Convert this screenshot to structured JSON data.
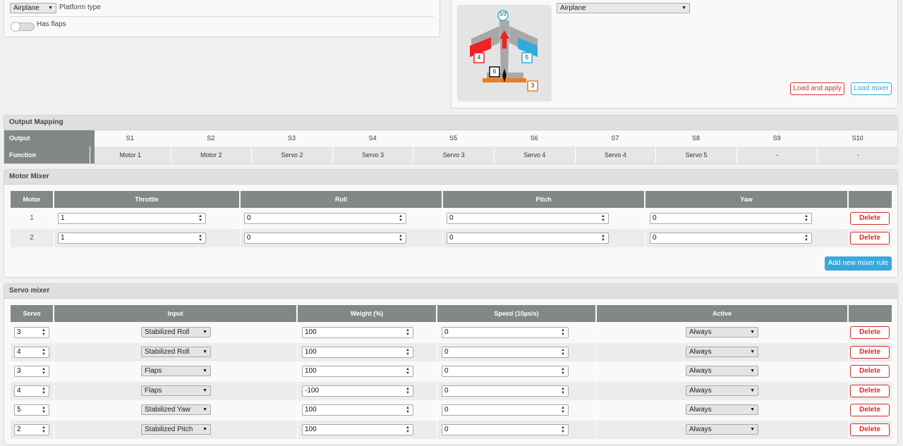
{
  "platform": {
    "type_value": "Airplane",
    "type_label": "Platform type",
    "flaps_label": "Has flaps"
  },
  "mixer_preset": {
    "value": "Airplane",
    "load_apply": "Load and apply",
    "load_mixer": "Load mixer",
    "diagram_labels": {
      "m12": "1/2",
      "s4": "4",
      "s5": "5",
      "s6": "6",
      "s3": "3"
    }
  },
  "output_mapping": {
    "title": "Output Mapping",
    "output_label": "Output",
    "function_label": "Function",
    "outputs": [
      "S1",
      "S2",
      "S3",
      "S4",
      "S5",
      "S6",
      "S7",
      "S8",
      "S9",
      "S10"
    ],
    "functions": [
      "Motor 1",
      "Motor 2",
      "Servo 2",
      "Servo 3",
      "Servo 3",
      "Servo 4",
      "Servo 4",
      "Servo 5",
      "-",
      "-"
    ]
  },
  "motor_mixer": {
    "title": "Motor Mixer",
    "headers": {
      "motor": "Motor",
      "throttle": "Throttle",
      "roll": "Roll",
      "pitch": "Pitch",
      "yaw": "Yaw"
    },
    "rows": [
      {
        "motor": "1",
        "throttle": "1",
        "roll": "0",
        "pitch": "0",
        "yaw": "0",
        "delete": "Delete"
      },
      {
        "motor": "2",
        "throttle": "1",
        "roll": "0",
        "pitch": "0",
        "yaw": "0",
        "delete": "Delete"
      }
    ],
    "add_rule": "Add new mixer rule"
  },
  "servo_mixer": {
    "title": "Servo mixer",
    "headers": {
      "servo": "Servo",
      "input": "Input",
      "weight": "Weight (%)",
      "speed": "Speed (10µs/s)",
      "active": "Active"
    },
    "rows": [
      {
        "servo": "3",
        "input": "Stabilized Roll",
        "weight": "100",
        "speed": "0",
        "active": "Always",
        "delete": "Delete"
      },
      {
        "servo": "4",
        "input": "Stabilized Roll",
        "weight": "100",
        "speed": "0",
        "active": "Always",
        "delete": "Delete"
      },
      {
        "servo": "3",
        "input": "Flaps",
        "weight": "100",
        "speed": "0",
        "active": "Always",
        "delete": "Delete"
      },
      {
        "servo": "4",
        "input": "Flaps",
        "weight": "-100",
        "speed": "0",
        "active": "Always",
        "delete": "Delete"
      },
      {
        "servo": "5",
        "input": "Stabilized Yaw",
        "weight": "100",
        "speed": "0",
        "active": "Always",
        "delete": "Delete"
      },
      {
        "servo": "2",
        "input": "Stabilized Pitch",
        "weight": "100",
        "speed": "0",
        "active": "Always",
        "delete": "Delete"
      }
    ]
  },
  "colors": {
    "header_gray": "#828885",
    "delete_red": "#d32f2f",
    "accent_blue": "#37a8db",
    "wing_red": "#ee2222",
    "wing_blue": "#33aadd",
    "tail_orange": "#f07d1a"
  }
}
